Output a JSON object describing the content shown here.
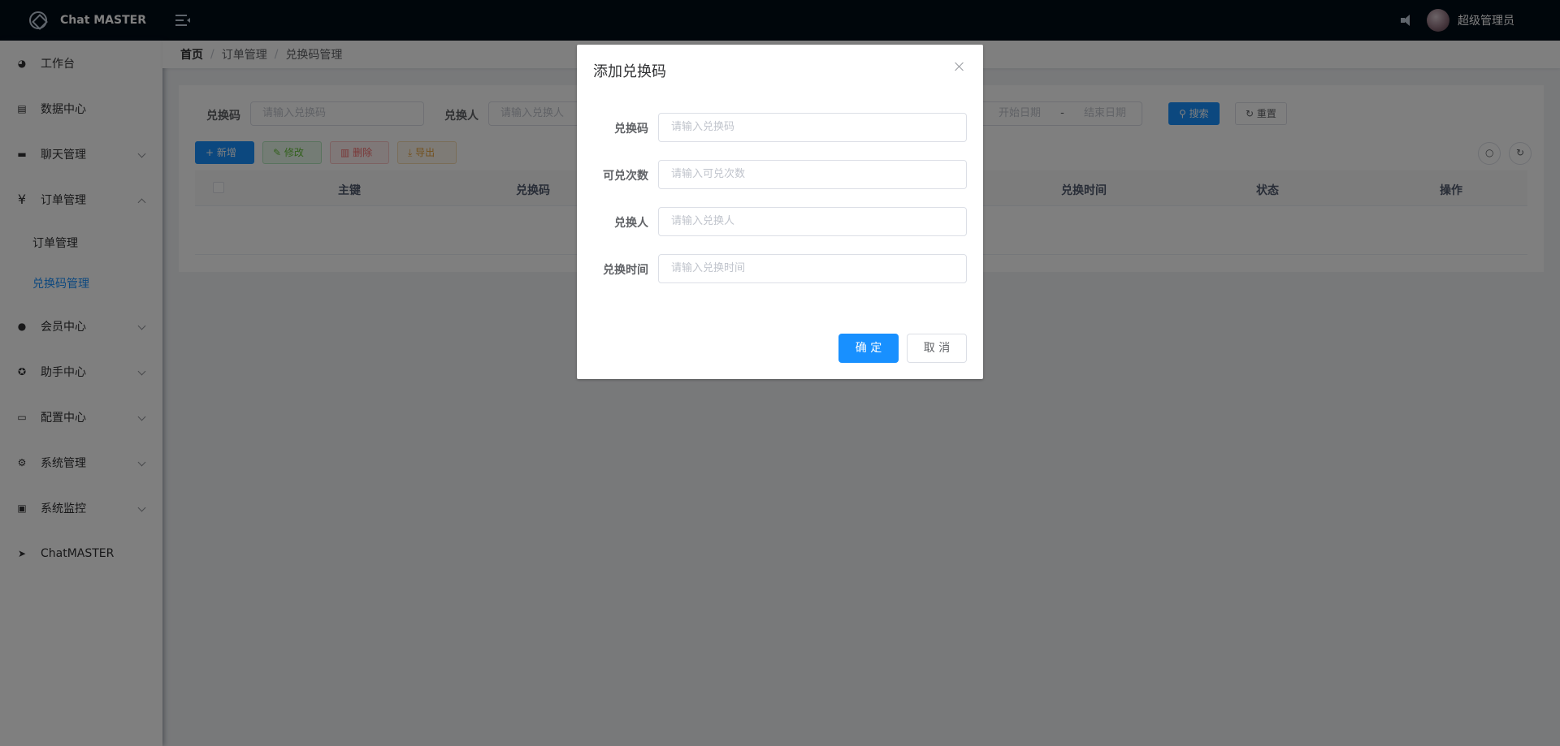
{
  "app": {
    "title": "Chat MASTER"
  },
  "header": {
    "username": "超级管理员"
  },
  "sidebar": {
    "items": [
      {
        "label": "工作台",
        "icon": "dashboard-icon"
      },
      {
        "label": "数据中心",
        "icon": "data-icon"
      },
      {
        "label": "聊天管理",
        "icon": "chat-icon"
      },
      {
        "label": "订单管理",
        "icon": "yen-icon"
      },
      {
        "label": "会员中心",
        "icon": "user-icon"
      },
      {
        "label": "助手中心",
        "icon": "assistant-icon"
      },
      {
        "label": "配置中心",
        "icon": "config-icon"
      },
      {
        "label": "系统管理",
        "icon": "gear-icon"
      },
      {
        "label": "系统监控",
        "icon": "monitor-icon"
      },
      {
        "label": "ChatMASTER",
        "icon": "send-icon"
      }
    ],
    "submenu": [
      {
        "label": "订单管理"
      },
      {
        "label": "兑换码管理"
      }
    ]
  },
  "breadcrumb": [
    "首页",
    "订单管理",
    "兑换码管理"
  ],
  "search": {
    "code_label": "兑换码",
    "code_placeholder": "请输入兑换码",
    "user_label": "兑换人",
    "user_placeholder": "请输入兑换人",
    "start_placeholder": "开始日期",
    "range_sep": "-",
    "end_placeholder": "结束日期",
    "search_button": "搜索",
    "reset_button": "重置"
  },
  "toolbar": {
    "add": "新增",
    "edit": "修改",
    "delete": "删除",
    "export": "导出"
  },
  "table": {
    "columns": [
      "主键",
      "兑换码",
      "兑换时间",
      "状态",
      "操作"
    ]
  },
  "dialog": {
    "title": "添加兑换码",
    "fields": [
      {
        "label": "兑换码",
        "placeholder": "请输入兑换码"
      },
      {
        "label": "可兑次数",
        "placeholder": "请输入可兑次数"
      },
      {
        "label": "兑换人",
        "placeholder": "请输入兑换人"
      },
      {
        "label": "兑换时间",
        "placeholder": "请输入兑换时间"
      }
    ],
    "ok": "确 定",
    "cancel": "取 消"
  }
}
